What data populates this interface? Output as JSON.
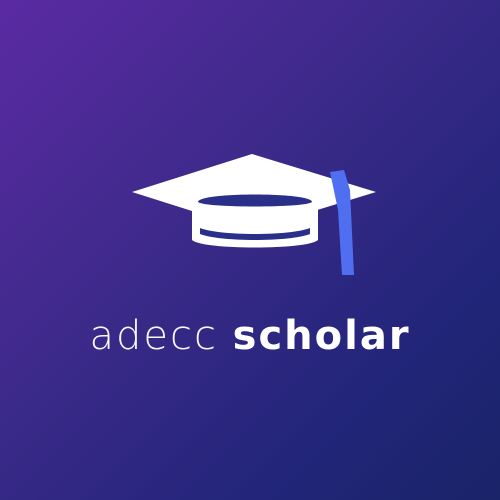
{
  "brand": {
    "name_light": "adecc",
    "name_bold": "scholar",
    "logo_icon": "graduation-cap-icon"
  },
  "colors": {
    "background_start": "#5b2aa3",
    "background_end": "#1a2468",
    "cap": "#ffffff",
    "tassel": "#4f6ff0"
  }
}
